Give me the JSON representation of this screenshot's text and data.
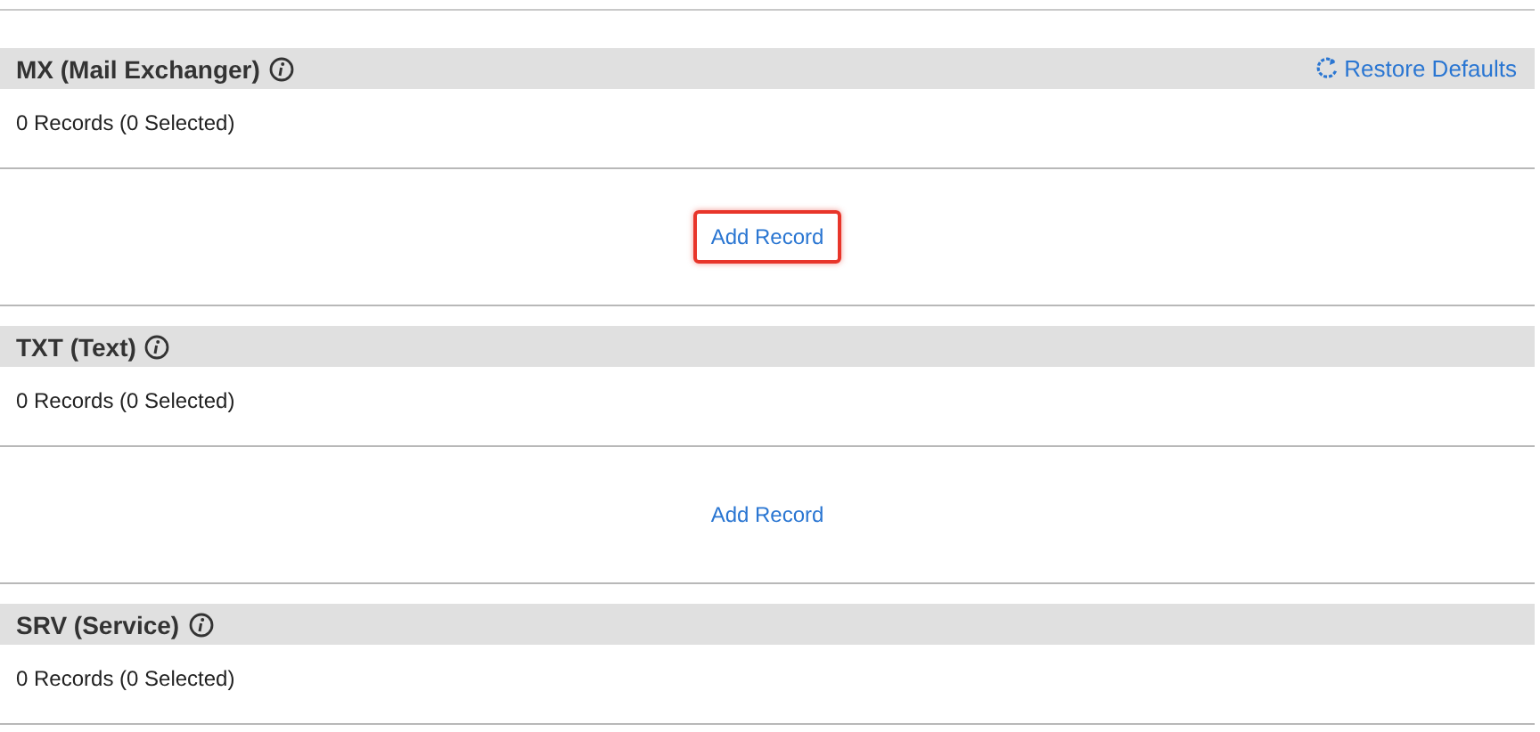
{
  "sections": [
    {
      "title": "MX (Mail Exchanger)",
      "action": "Restore Defaults",
      "summary": "0 Records (0 Selected)",
      "add_record": {
        "label": "Add Record",
        "highlighted": true
      }
    },
    {
      "title": "TXT (Text)",
      "summary": "0 Records (0 Selected)",
      "add_record": {
        "label": "Add Record",
        "highlighted": false
      }
    },
    {
      "title": "SRV (Service)",
      "summary": "0 Records (0 Selected)"
    }
  ]
}
